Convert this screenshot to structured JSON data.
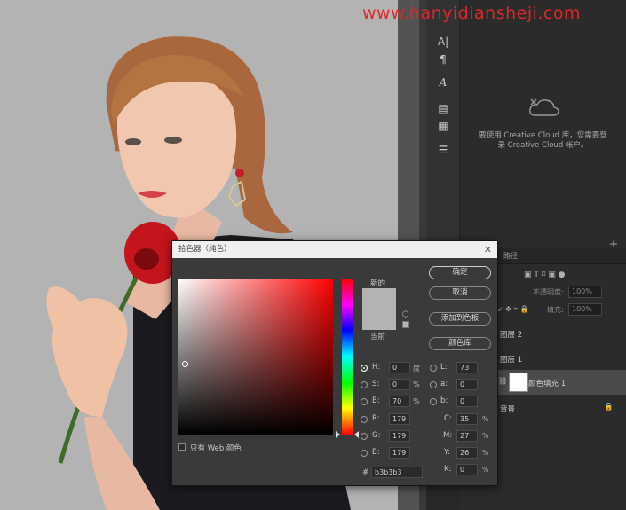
{
  "watermark": "www.hanyidiansheji.com",
  "cc_message": {
    "line1": "要使用 Creative Cloud 库，您需要登",
    "line2": "录 Creative Cloud 帐户。"
  },
  "tools": {
    "paragraph_text": "A|",
    "pilcrow": "¶",
    "glyph": "A"
  },
  "layers_panel": {
    "tab_label": "路径",
    "opacity_label": "不透明度:",
    "opacity_value": "100%",
    "fill_label": "填充:",
    "fill_value": "100%",
    "layers": [
      {
        "name": "图层 2"
      },
      {
        "name": "图层 1"
      },
      {
        "name": "颜色填充 1",
        "selected": true
      },
      {
        "name": "背景"
      }
    ]
  },
  "dialog": {
    "title": "拾色器（纯色）",
    "new_label": "新的",
    "current_label": "当前",
    "buttons": {
      "ok": "确定",
      "cancel": "取消",
      "add_to_swatches": "添加到色板",
      "color_libraries": "颜色库"
    },
    "web_only_label": "只有 Web 颜色",
    "hsb": {
      "H": "0",
      "S": "0",
      "B": "70",
      "h_unit": "度",
      "s_unit": "%",
      "b_unit": "%"
    },
    "rgb": {
      "R": "179",
      "G": "179",
      "B": "179"
    },
    "lab": {
      "L": "73",
      "a": "0",
      "b": "0"
    },
    "cmyk": {
      "C": "35",
      "M": "27",
      "Y": "26",
      "K": "0"
    },
    "hex": "b3b3b3"
  },
  "colors": {
    "selected": "#b3b3b3",
    "watermark": "#e0262b"
  }
}
